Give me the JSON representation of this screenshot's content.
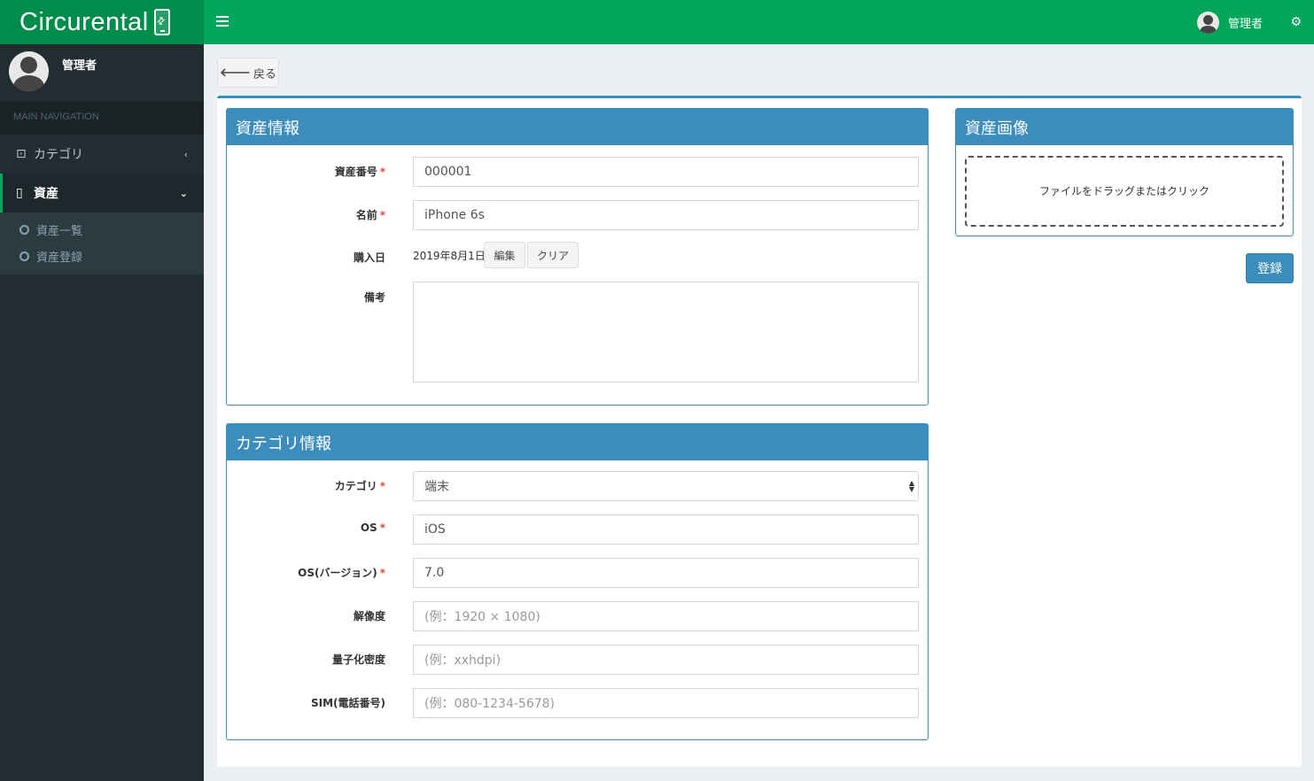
{
  "app": {
    "logo": "Circurental"
  },
  "header": {
    "user_name": "管理者"
  },
  "sidebar": {
    "user_name": "管理者",
    "nav_header": "MAIN NAVIGATION",
    "items": [
      {
        "label": "カテゴリ"
      },
      {
        "label": "資産"
      }
    ],
    "sub_items": [
      {
        "label": "資産一覧"
      },
      {
        "label": "資産登録"
      }
    ]
  },
  "back_button": "戻る",
  "asset_panel": {
    "title": "資産情報",
    "fields": {
      "number": {
        "label": "資産番号",
        "required": "*",
        "value": "000001"
      },
      "name": {
        "label": "名前",
        "required": "*",
        "value": "iPhone 6s"
      },
      "purchase": {
        "label": "購入日",
        "value": "2019年8月1日",
        "edit": "編集",
        "clear": "クリア"
      },
      "note": {
        "label": "備考",
        "value": ""
      }
    }
  },
  "category_panel": {
    "title": "カテゴリ情報",
    "fields": {
      "category": {
        "label": "カテゴリ",
        "required": "*",
        "value": "端末"
      },
      "os": {
        "label": "OS",
        "required": "*",
        "value": "iOS"
      },
      "os_version": {
        "label": "OS(バージョン)",
        "required": "*",
        "value": "7.0"
      },
      "resolution": {
        "label": "解像度",
        "placeholder": "(例：1920 × 1080)"
      },
      "density": {
        "label": "量子化密度",
        "placeholder": "(例：xxhdpi)"
      },
      "sim": {
        "label": "SIM(電話番号)",
        "placeholder": "(例：080-1234-5678)"
      }
    }
  },
  "image_panel": {
    "title": "資産画像",
    "dropzone": "ファイルをドラッグまたはクリック"
  },
  "submit_button": "登録"
}
